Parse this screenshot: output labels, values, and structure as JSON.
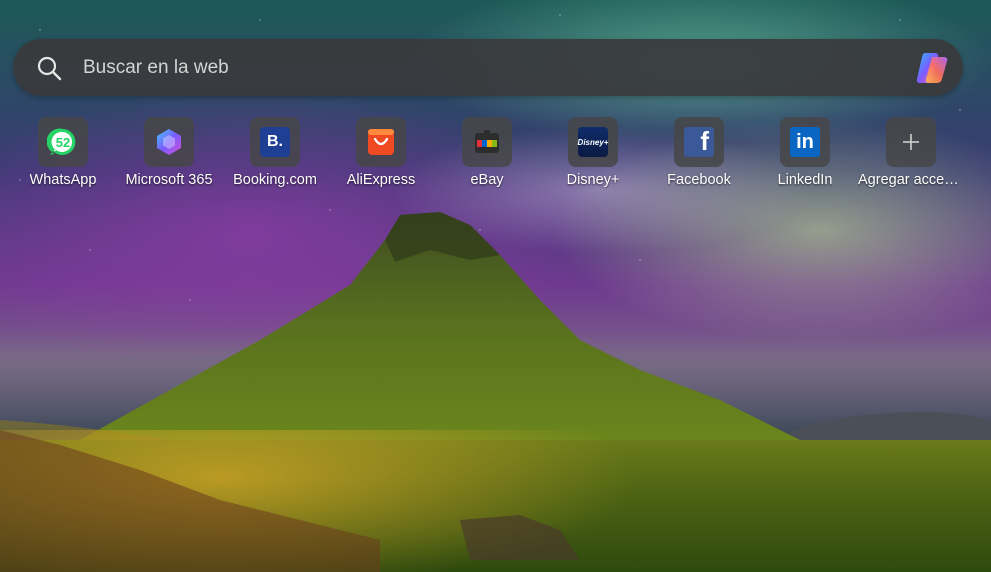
{
  "search": {
    "placeholder": "Buscar en la web",
    "icon": "search-icon",
    "copilot_icon": "copilot-icon"
  },
  "quick_links": [
    {
      "label": "WhatsApp",
      "icon": "whatsapp-icon",
      "badge": "52",
      "color": "#25d366"
    },
    {
      "label": "Microsoft 365",
      "icon": "microsoft-365-icon",
      "color": "#7b5cff"
    },
    {
      "label": "Booking.com",
      "icon": "booking-icon",
      "letter": "B.",
      "color": "#1f3f95"
    },
    {
      "label": "AliExpress",
      "icon": "aliexpress-icon",
      "color": "#f04a23"
    },
    {
      "label": "eBay",
      "icon": "ebay-icon",
      "color": "#e53238"
    },
    {
      "label": "Disney+",
      "icon": "disney-plus-icon",
      "logo_text": "Disney+",
      "color": "#0f2d6b"
    },
    {
      "label": "Facebook",
      "icon": "facebook-icon",
      "letter": "f",
      "color": "#3b5998"
    },
    {
      "label": "LinkedIn",
      "icon": "linkedin-icon",
      "letter": "in",
      "color": "#0a66c2"
    },
    {
      "label": "Agregar acceso directo",
      "icon": "plus-icon"
    }
  ]
}
